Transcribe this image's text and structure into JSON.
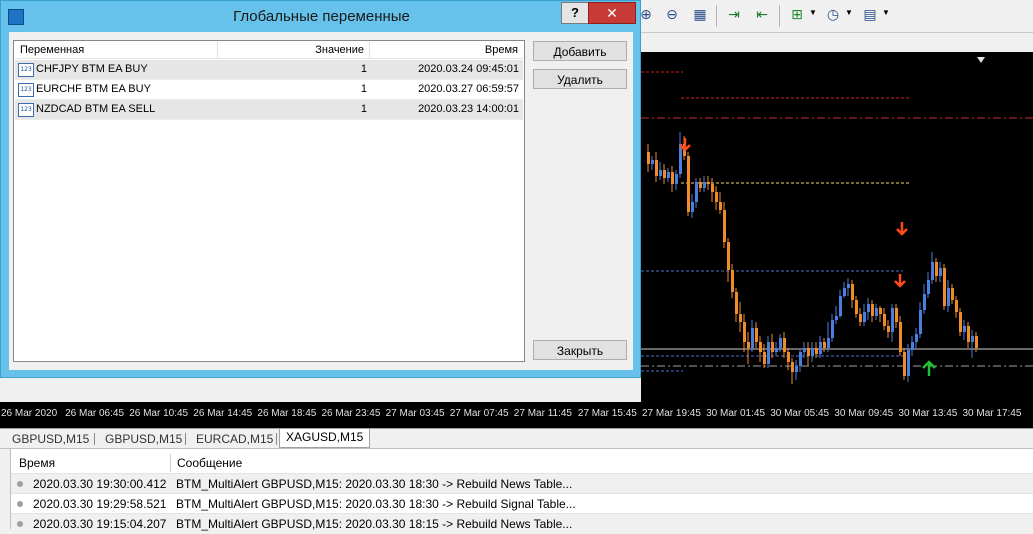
{
  "dialog": {
    "title": "Глобальные переменные",
    "help_label": "?",
    "close_glyph": "✕",
    "columns": [
      "Переменная",
      "Значение",
      "Время"
    ],
    "rows": [
      {
        "name": "CHFJPY BTM EA BUY",
        "value": "1",
        "time": "2020.03.24 09:45:01"
      },
      {
        "name": "EURCHF BTM EA BUY",
        "value": "1",
        "time": "2020.03.27 06:59:57"
      },
      {
        "name": "NZDCAD BTM EA SELL",
        "value": "1",
        "time": "2020.03.23 14:00:01"
      }
    ],
    "row_icon": "123",
    "buttons": {
      "add": "Добавить",
      "delete": "Удалить",
      "close": "Закрыть"
    }
  },
  "toolbar": {
    "icons": [
      "zoom-in-icon",
      "zoom-out-icon",
      "tile-windows-icon",
      "auto-scroll-icon",
      "chart-shift-icon",
      "indicators-icon",
      "periods-icon",
      "templates-icon"
    ]
  },
  "time_axis": {
    "labels": [
      "26 Mar 2020",
      "26 Mar 06:45",
      "26 Mar 10:45",
      "26 Mar 14:45",
      "26 Mar 18:45",
      "26 Mar 23:45",
      "27 Mar 03:45",
      "27 Mar 07:45",
      "27 Mar 11:45",
      "27 Mar 15:45",
      "27 Mar 19:45",
      "30 Mar 01:45",
      "30 Mar 05:45",
      "30 Mar 09:45",
      "30 Mar 13:45",
      "30 Mar 17:45"
    ]
  },
  "tabs": [
    {
      "label": "GBPUSD,M15",
      "active": false
    },
    {
      "label": "GBPUSD,M15",
      "active": false
    },
    {
      "label": "EURCAD,M15",
      "active": false
    },
    {
      "label": "XAGUSD,M15",
      "active": true
    }
  ],
  "journal": {
    "columns": [
      "Время",
      "Сообщение"
    ],
    "rows": [
      {
        "time": "2020.03.30 19:30:00.412",
        "message": "BTM_MultiAlert GBPUSD,M15: 2020.03.30 18:30 -> Rebuild News Table..."
      },
      {
        "time": "2020.03.30 19:29:58.521",
        "message": "BTM_MultiAlert GBPUSD,M15: 2020.03.30 18:30 -> Rebuild Signal Table..."
      },
      {
        "time": "2020.03.30 19:15:04.207",
        "message": "BTM_MultiAlert GBPUSD,M15: 2020.03.30 18:15 -> Rebuild News Table..."
      }
    ]
  },
  "colors": {
    "dialog_frame": "#66c2ea",
    "close_button": "#c73a35",
    "bull_candle": "#4a7fe0",
    "bear_candle": "#f08c28",
    "sell_arrow": "#ff4a1a",
    "buy_arrow": "#22c033"
  }
}
